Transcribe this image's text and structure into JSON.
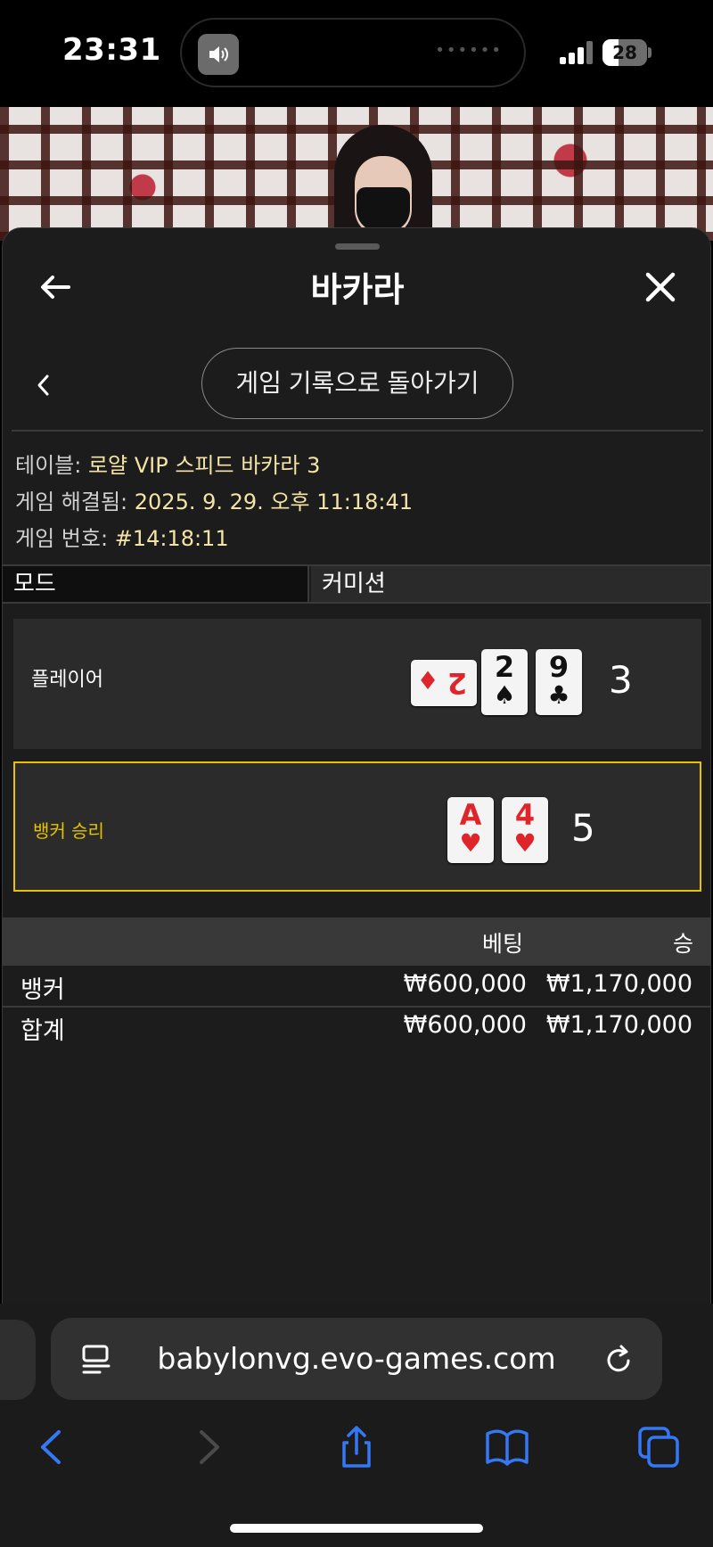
{
  "status": {
    "time": "23:31",
    "battery": "28"
  },
  "sheet": {
    "title": "바카라",
    "return_button": "게임 기록으로 돌아가기",
    "info": {
      "table_label": "테이블:",
      "table_value": "로얄 VIP 스피드 바카라 3",
      "resolved_label": "게임 해결됨:",
      "resolved_value": "2025. 9. 29. 오후 11:18:41",
      "number_label": "게임 번호:",
      "number_value": "#14:18:11"
    },
    "mode": {
      "label": "모드",
      "value": "커미션"
    },
    "player": {
      "label": "플레이어",
      "cards": [
        {
          "rank": "2",
          "suit": "♦",
          "color": "red",
          "orientation": "sideways"
        },
        {
          "rank": "2",
          "suit": "♠",
          "color": "black"
        },
        {
          "rank": "9",
          "suit": "♣",
          "color": "black"
        }
      ],
      "score": "3"
    },
    "banker": {
      "label": "뱅커 승리",
      "cards": [
        {
          "rank": "A",
          "suit": "♥",
          "color": "red"
        },
        {
          "rank": "4",
          "suit": "♥",
          "color": "red"
        }
      ],
      "score": "5",
      "highlight_color": "#e6c200"
    },
    "bets": {
      "headers": {
        "bet": "베팅",
        "win": "승"
      },
      "rows": [
        {
          "name": "뱅커",
          "bet": "₩600,000",
          "win": "₩1,170,000"
        },
        {
          "name": "합계",
          "bet": "₩600,000",
          "win": "₩1,170,000"
        }
      ]
    }
  },
  "browser": {
    "url": "babylonvg.evo-games.com",
    "accent": "#3478f6"
  }
}
